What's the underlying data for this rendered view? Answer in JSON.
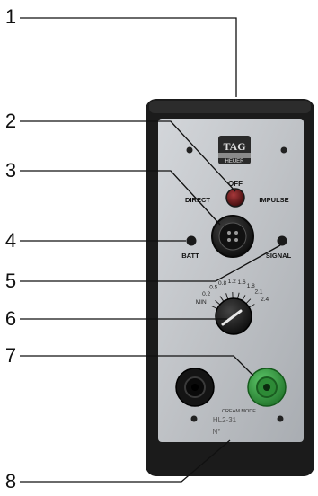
{
  "callouts": [
    "1",
    "2",
    "3",
    "4",
    "5",
    "6",
    "7",
    "8"
  ],
  "brand": {
    "line1": "TAG",
    "line2": "HEUER"
  },
  "switch": {
    "top_label": "OFF",
    "left_label": "DIRECT",
    "right_label": "IMPULSE"
  },
  "indicators": {
    "left_label": "BATT",
    "right_label": "SIGNAL"
  },
  "dial": {
    "ticks": [
      "MIN",
      "0.2",
      "0.5",
      "0.8",
      "1.2",
      "1.6",
      "1.8",
      "2.1",
      "2.4"
    ]
  },
  "plate": {
    "line1": "CREAM MODE",
    "line2": "HL2-31",
    "line3": "N°"
  },
  "colors": {
    "housing": "#1b1b1b",
    "faceplate": "#c3c6ca",
    "terminal_green": "#2f9b3a",
    "terminal_black": "#141414",
    "switch_red": "#5a1416",
    "leader": "#111111"
  }
}
